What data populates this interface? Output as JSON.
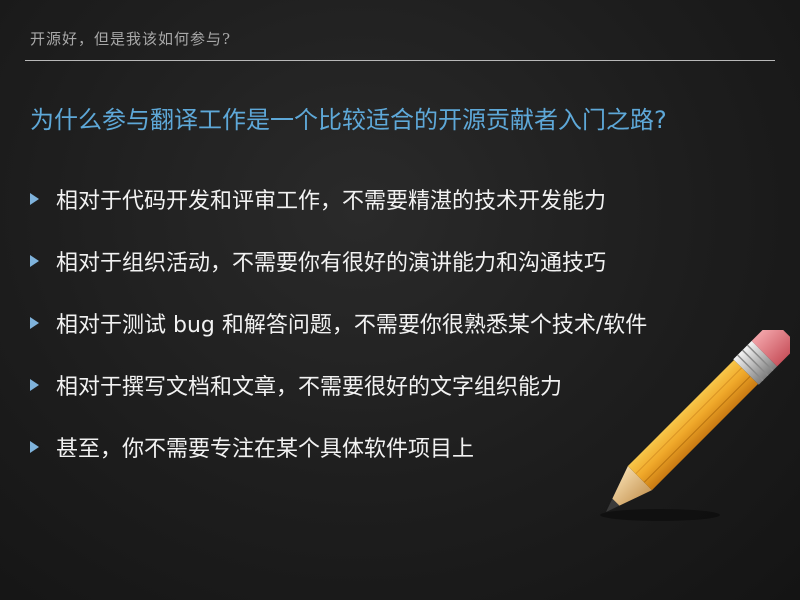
{
  "header": {
    "text": "开源好，但是我该如何参与?"
  },
  "title": "为什么参与翻译工作是一个比较适合的开源贡献者入门之路?",
  "bullets": [
    "相对于代码开发和评审工作，不需要精湛的技术开发能力",
    "相对于组织活动，不需要你有很好的演讲能力和沟通技巧",
    "相对于测试 bug 和解答问题，不需要你很熟悉某个技术/软件",
    "相对于撰写文档和文章，不需要很好的文字组织能力",
    "甚至，你不需要专注在某个具体软件项目上"
  ],
  "colors": {
    "background": "#1d1d1d",
    "title": "#5ea8d8",
    "header": "#a8a8a8",
    "bullet_text": "#f2f2f2",
    "bullet_arrow": "#7fb3dc"
  },
  "icons": {
    "bullet": "triangle-right-icon",
    "illustration": "pencil-icon"
  }
}
